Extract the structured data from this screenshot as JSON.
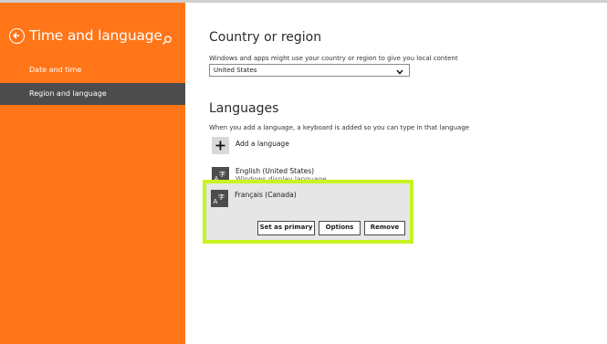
{
  "sidebar": {
    "title": "Time and language",
    "items": [
      {
        "label": "Date and time"
      },
      {
        "label": "Region and language"
      }
    ]
  },
  "country": {
    "heading": "Country or region",
    "description": "Windows and apps might use your country or region to give you local content",
    "selected": "United States"
  },
  "languages": {
    "heading": "Languages",
    "description": "When you add a language, a keyboard is added so you can type in that language",
    "add_label": "Add a language",
    "items": [
      {
        "name": "English (United States)",
        "sub": "Windows display language"
      },
      {
        "name": "Français (Canada)"
      }
    ],
    "buttons": {
      "set_primary": "Set as primary",
      "options": "Options",
      "remove": "Remove"
    }
  },
  "colors": {
    "accent": "#ff7517",
    "active_item": "#4c4c4c",
    "highlight": "#c6f520"
  }
}
